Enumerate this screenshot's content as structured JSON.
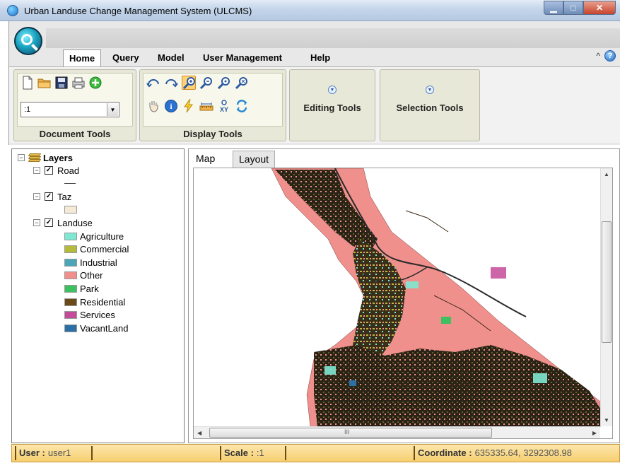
{
  "window": {
    "title": "Urban Landuse Change Management System (ULCMS)",
    "min_glyph": "▁",
    "max_glyph": "□",
    "close_glyph": "✕"
  },
  "ribbon": {
    "tabs": [
      "Home",
      "Query",
      "Model",
      "User Management",
      "Help"
    ],
    "active_tab": "Home",
    "collapse_glyph": "^",
    "help_glyph": "?",
    "document_tools": {
      "label": "Document Tools",
      "icons": [
        "new-document-icon",
        "open-folder-icon",
        "save-icon",
        "print-icon",
        "add-layer-icon"
      ],
      "scale_combo_value": ":1"
    },
    "display_tools": {
      "label": "Display Tools",
      "row1_icons": [
        "undo-extent-icon",
        "redo-extent-icon",
        "zoom-in-icon",
        "zoom-out-icon",
        "fixed-zoom-in-icon",
        "fixed-zoom-out-icon"
      ],
      "row2_icons": [
        "pan-hand-icon",
        "identify-icon",
        "flash-icon",
        "measure-icon",
        "goto-xy-icon",
        "refresh-icon"
      ]
    },
    "editing_tools": {
      "label": "Editing Tools"
    },
    "selection_tools": {
      "label": "Selection Tools"
    }
  },
  "layers": {
    "root_label": "Layers",
    "road": {
      "label": "Road",
      "checked": true
    },
    "taz": {
      "label": "Taz",
      "checked": true,
      "color": "#f5ead6"
    },
    "landuse": {
      "label": "Landuse",
      "checked": true,
      "classes": [
        {
          "label": "Agriculture",
          "color": "#7ee8d2"
        },
        {
          "label": "Commercial",
          "color": "#b5ba3c"
        },
        {
          "label": "Industrial",
          "color": "#4aa6b8"
        },
        {
          "label": "Other",
          "color": "#f0908c"
        },
        {
          "label": "Park",
          "color": "#3cc060"
        },
        {
          "label": "Residential",
          "color": "#6a4a18"
        },
        {
          "label": "Services",
          "color": "#c44a9a"
        },
        {
          "label": "VacantLand",
          "color": "#2c6ea6"
        }
      ]
    }
  },
  "map": {
    "tabs": [
      "Map",
      "Layout"
    ],
    "active_tab": "Map",
    "scroll_glyph": "III"
  },
  "status": {
    "user_label": "User :",
    "user_value": "user1",
    "scale_label": "Scale :",
    "scale_value": ":1",
    "coord_label": "Coordinate :",
    "coord_value": "635335.64, 3292308.98"
  }
}
